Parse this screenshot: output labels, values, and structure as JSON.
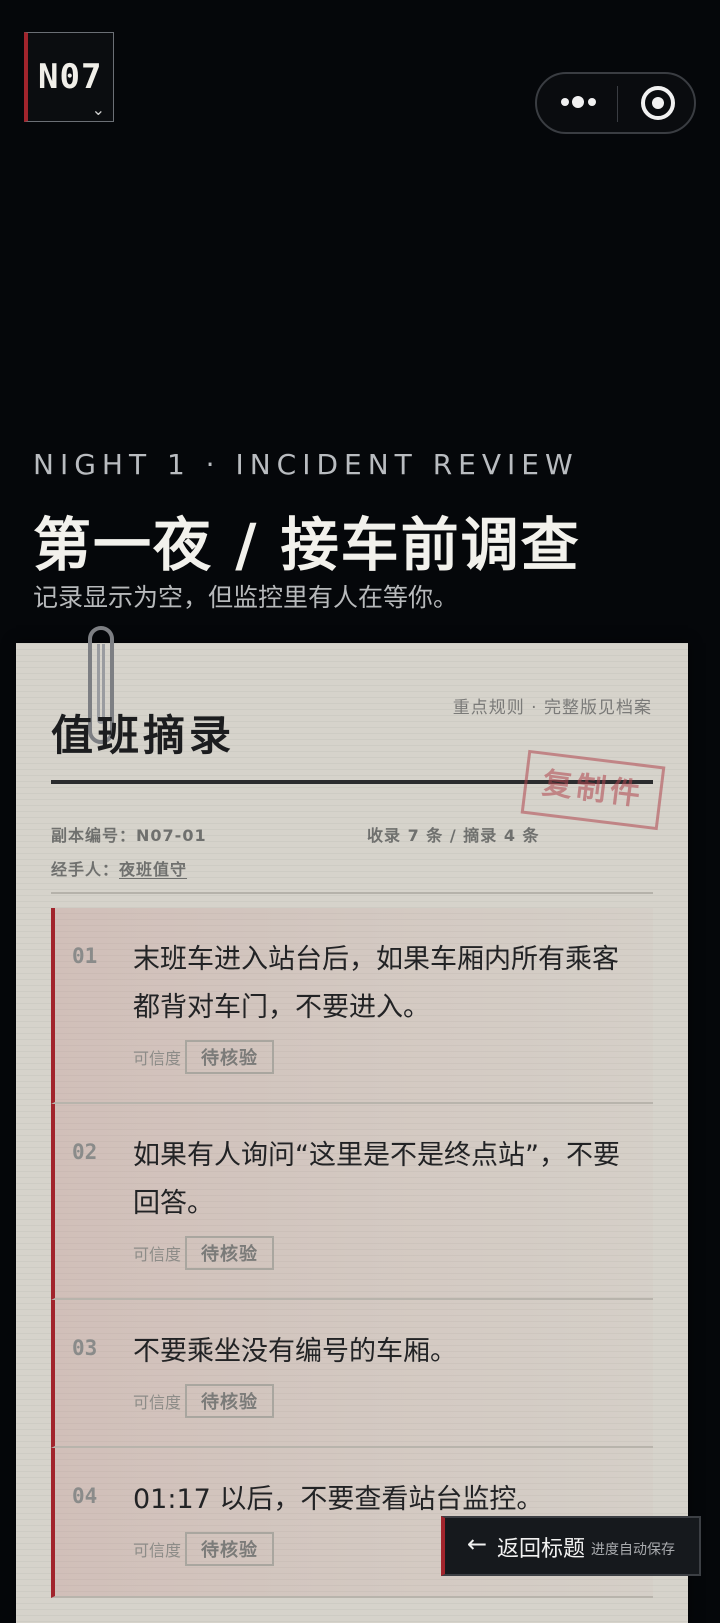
{
  "header": {
    "badge_code": "N07",
    "badge_chevron": "chevron-down-icon",
    "capsule_menu_icon": "more-dots-icon",
    "capsule_close_icon": "target-icon"
  },
  "hero": {
    "eyebrow": "NIGHT 1 · INCIDENT REVIEW",
    "title": "第一夜 / 接车前调查",
    "subtitle": "记录显示为空，但监控里有人在等你。"
  },
  "paper": {
    "title": "值班摘录",
    "note": "重点规则 · 完整版见档案",
    "stamp": "复制件",
    "copy_number_label": "副本编号：",
    "copy_number": "N07-01",
    "count_text": "收录 7 条 / 摘录 4 条",
    "handler_label": "经手人：",
    "handler": "夜班值守",
    "credibility_label": "可信度",
    "rules": [
      {
        "num": "01",
        "text": "末班车进入站台后，如果车厢内所有乘客都背对车门，不要进入。",
        "status": "待核验"
      },
      {
        "num": "02",
        "text": "如果有人询问“这里是不是终点站”，不要回答。",
        "status": "待核验"
      },
      {
        "num": "03",
        "text": "不要乘坐没有编号的车厢。",
        "status": "待核验"
      },
      {
        "num": "04",
        "text": "01:17 以后，不要查看站台监控。",
        "status": "待核验"
      }
    ]
  },
  "footer": {
    "back_arrow": "←",
    "back_label": "返回标题",
    "back_hint": "进度自动保存"
  },
  "colors": {
    "background": "#05070a",
    "accent_red": "#a1242c",
    "paper": "#d6d3cb"
  }
}
